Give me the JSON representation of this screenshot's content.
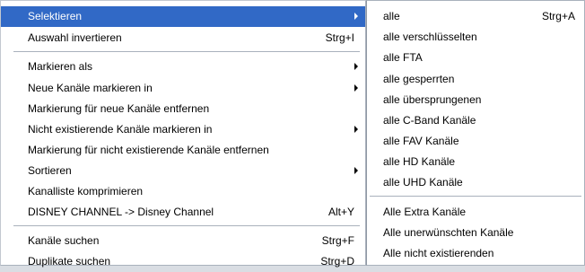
{
  "main_menu": {
    "items": [
      {
        "label": "Selektieren",
        "shortcut": "",
        "submenu": true,
        "highlighted": true
      },
      {
        "label": "Auswahl invertieren",
        "shortcut": "Strg+I",
        "submenu": false
      },
      {
        "label": "Markieren als",
        "shortcut": "",
        "submenu": true
      },
      {
        "label": "Neue Kanäle markieren in",
        "shortcut": "",
        "submenu": true
      },
      {
        "label": "Markierung für neue Kanäle entfernen",
        "shortcut": "",
        "submenu": false
      },
      {
        "label": "Nicht existierende Kanäle markieren in",
        "shortcut": "",
        "submenu": true
      },
      {
        "label": "Markierung für nicht existierende Kanäle entfernen",
        "shortcut": "",
        "submenu": false
      },
      {
        "label": "Sortieren",
        "shortcut": "",
        "submenu": true
      },
      {
        "label": "Kanalliste komprimieren",
        "shortcut": "",
        "submenu": false
      },
      {
        "label": "DISNEY CHANNEL -> Disney Channel",
        "shortcut": "Alt+Y",
        "submenu": false
      },
      {
        "label": "Kanäle suchen",
        "shortcut": "Strg+F",
        "submenu": false
      },
      {
        "label": "Duplikate suchen",
        "shortcut": "Strg+D",
        "submenu": false
      }
    ]
  },
  "sub_menu": {
    "items": [
      {
        "label": "alle",
        "shortcut": "Strg+A"
      },
      {
        "label": "alle verschlüsselten",
        "shortcut": ""
      },
      {
        "label": "alle FTA",
        "shortcut": ""
      },
      {
        "label": "alle gesperrten",
        "shortcut": ""
      },
      {
        "label": "alle übersprungenen",
        "shortcut": ""
      },
      {
        "label": "alle C-Band Kanäle",
        "shortcut": ""
      },
      {
        "label": "alle FAV Kanäle",
        "shortcut": ""
      },
      {
        "label": "alle HD Kanäle",
        "shortcut": ""
      },
      {
        "label": "alle UHD Kanäle",
        "shortcut": ""
      },
      {
        "label": "Alle Extra Kanäle",
        "shortcut": ""
      },
      {
        "label": "Alle unerwünschten Kanäle",
        "shortcut": ""
      },
      {
        "label": "Alle nicht existierenden",
        "shortcut": ""
      }
    ]
  },
  "colors": {
    "highlight": "#3169c6",
    "menu_background": "#ffffff",
    "separator": "#a9b1bc"
  },
  "icons": {
    "submenu_arrow": "chevron-right-icon"
  }
}
